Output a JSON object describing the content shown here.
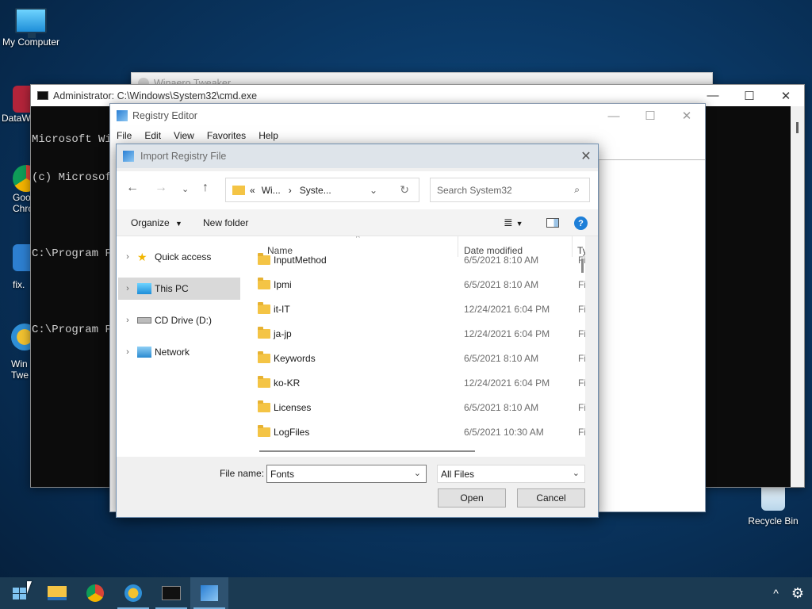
{
  "desktop": {
    "icons": [
      {
        "label": "My Computer"
      },
      {
        "label": "DataW"
      },
      {
        "label": "Goo"
      },
      {
        "label": "Chro"
      },
      {
        "label": "fix."
      },
      {
        "label": "Win"
      },
      {
        "label": "Twe"
      },
      {
        "label": "Recycle Bin"
      }
    ]
  },
  "winaero_window": {
    "title": "Winaero Tweaker"
  },
  "cmd": {
    "title": "Administrator: C:\\Windows\\System32\\cmd.exe",
    "lines": [
      "Microsoft Wi",
      "(c) Microsof",
      "",
      "C:\\Program F",
      "",
      "C:\\Program F"
    ]
  },
  "regedit": {
    "title": "Registry Editor",
    "menu": [
      "File",
      "Edit",
      "View",
      "Favorites",
      "Help"
    ]
  },
  "dialog": {
    "title": "Import Registry File",
    "address": {
      "prefix": "«",
      "crumb1": "Wi...",
      "sep": "›",
      "crumb2": "Syste..."
    },
    "search_placeholder": "Search System32",
    "toolbar": {
      "organize": "Organize",
      "new_folder": "New folder"
    },
    "nav": [
      {
        "label": "Quick access"
      },
      {
        "label": "This PC"
      },
      {
        "label": "CD Drive (D:)"
      },
      {
        "label": "Network"
      }
    ],
    "columns": {
      "name": "Name",
      "date": "Date modified",
      "type": "Ty"
    },
    "files": [
      {
        "name": "InputMethod",
        "date": "6/5/2021 8:10 AM",
        "type": "Fi"
      },
      {
        "name": "Ipmi",
        "date": "6/5/2021 8:10 AM",
        "type": "Fi"
      },
      {
        "name": "it-IT",
        "date": "12/24/2021 6:04 PM",
        "type": "Fi"
      },
      {
        "name": "ja-jp",
        "date": "12/24/2021 6:04 PM",
        "type": "Fi"
      },
      {
        "name": "Keywords",
        "date": "6/5/2021 8:10 AM",
        "type": "Fi"
      },
      {
        "name": "ko-KR",
        "date": "12/24/2021 6:04 PM",
        "type": "Fi"
      },
      {
        "name": "Licenses",
        "date": "6/5/2021 8:10 AM",
        "type": "Fi"
      },
      {
        "name": "LogFiles",
        "date": "6/5/2021 10:30 AM",
        "type": "Fi"
      }
    ],
    "file_name_label": "File name:",
    "file_name_value": "Fonts",
    "filter_value": "All Files",
    "open_label": "Open",
    "cancel_label": "Cancel"
  },
  "colors": {
    "taskbar": "#1b3a52",
    "dialog_title": "#dee4ea",
    "folder": "#f4c445"
  }
}
